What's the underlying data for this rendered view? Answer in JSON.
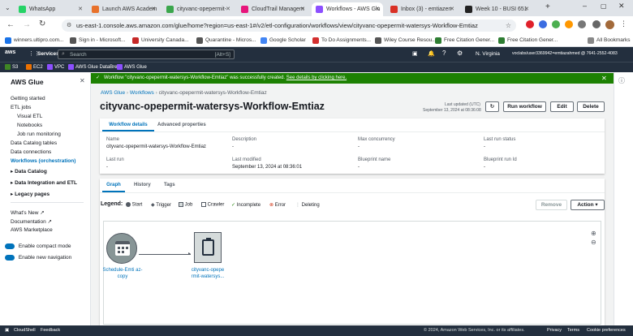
{
  "browser": {
    "tabs": [
      {
        "label": "WhatsApp",
        "color": "#25d366"
      },
      {
        "label": "Launch AWS Academ",
        "color": "#e8712b"
      },
      {
        "label": "cityvanc-opepermit-",
        "color": "#3aa64c"
      },
      {
        "label": "CloudTrail Managem",
        "color": "#e7157b"
      },
      {
        "label": "Workflows - AWS Glu",
        "color": "#8c4fff"
      },
      {
        "label": "Inbox (3) - emtiazen",
        "color": "#d93025"
      },
      {
        "label": "Week 10 - BUSI 651",
        "color": "#222222"
      }
    ],
    "url": "us-east-1.console.aws.amazon.com/glue/home?region=us-east-1#/v2/etl-configuration/workflows/view/cityvanc-opepermit-watersys-Workflow-Emtiaz",
    "bookmarks": [
      "winners.ultipro.com...",
      "Sign in - Microsoft...",
      "University Canada...",
      "Quarantine - Micros...",
      "Google Scholar",
      "To Do Assignments...",
      "Wiley Course Resou...",
      "Free Citation Gener...",
      "Free Citation Gener..."
    ],
    "all_bookmarks": "All Bookmarks"
  },
  "aws": {
    "logo": "aws",
    "services": "Services",
    "search_placeholder": "Search",
    "search_shortcut": "[Alt+S]",
    "region": "N. Virginia",
    "account": "voclabs/user3369942=emtiazahmed @ 7641-2552-4083",
    "favorites": [
      "S3",
      "EC2",
      "VPC",
      "AWS Glue DataBrew",
      "AWS Glue"
    ]
  },
  "sidebar": {
    "title": "AWS Glue",
    "items": [
      {
        "label": "Getting started",
        "level": 0
      },
      {
        "label": "ETL jobs",
        "level": 0
      },
      {
        "label": "Visual ETL",
        "level": 1
      },
      {
        "label": "Notebooks",
        "level": 1
      },
      {
        "label": "Job run monitoring",
        "level": 1
      },
      {
        "label": "Data Catalog tables",
        "level": 0
      },
      {
        "label": "Data connections",
        "level": 0
      },
      {
        "label": "Workflows (orchestration)",
        "level": 0
      }
    ],
    "sections": [
      "Data Catalog",
      "Data Integration and ETL",
      "Legacy pages"
    ],
    "whats_new": "What's New",
    "documentation": "Documentation",
    "marketplace": "AWS Marketplace",
    "toggle_compact": "Enable compact mode",
    "toggle_nav": "Enable new navigation"
  },
  "banner": {
    "text": "Workflow \"cityvanc-opepermit-watersys-Workflow-Emtiaz\" was successfully created.",
    "link": "See details by clicking here."
  },
  "breadcrumb": [
    "AWS Glue",
    "Workflows",
    "cityvanc-opepermit-watersys-Workflow-Emtiaz"
  ],
  "page": {
    "title": "cityvanc-opepermit-watersys-Workflow-Emtiaz",
    "last_updated_label": "Last updated (UTC)",
    "last_updated_value": "September 13, 2024 at 08:36:08",
    "buttons": {
      "run": "Run workflow",
      "edit": "Edit",
      "delete": "Delete"
    }
  },
  "detail_tabs": [
    "Workflow details",
    "Advanced properties"
  ],
  "details": [
    {
      "label": "Name",
      "value": "cityvanc-opepermit-watersys-Workflow-Emtiaz"
    },
    {
      "label": "Description",
      "value": "-"
    },
    {
      "label": "Max concurrency",
      "value": "-"
    },
    {
      "label": "Last run status",
      "value": "-"
    },
    {
      "label": "Last run",
      "value": "-"
    },
    {
      "label": "Last modified",
      "value": "September 13, 2024 at 08:36:01"
    },
    {
      "label": "Blueprint name",
      "value": "-"
    },
    {
      "label": "Blueprint run Id",
      "value": "-"
    }
  ],
  "graph_tabs": [
    "Graph",
    "History",
    "Tags"
  ],
  "legend": {
    "title": "Legend:",
    "items": [
      "Start",
      "Trigger",
      "Job",
      "Crawler",
      "Incomplete",
      "Error",
      "Deleting"
    ]
  },
  "graph_buttons": {
    "remove": "Remove",
    "action": "Action"
  },
  "nodes": {
    "trigger": "Schedule-Emti az-copy",
    "job": "cityvanc-opepe rmit-watersys..."
  },
  "footer": {
    "cloudshell": "CloudShell",
    "feedback": "Feedback",
    "copyright": "© 2024, Amazon Web Services, Inc. or its affiliates.",
    "privacy": "Privacy",
    "terms": "Terms",
    "cookies": "Cookie preferences"
  },
  "colors": {
    "success": "#1d8102",
    "link": "#0073bb",
    "aws_dark": "#232f3e",
    "primary": "#ec7211"
  }
}
